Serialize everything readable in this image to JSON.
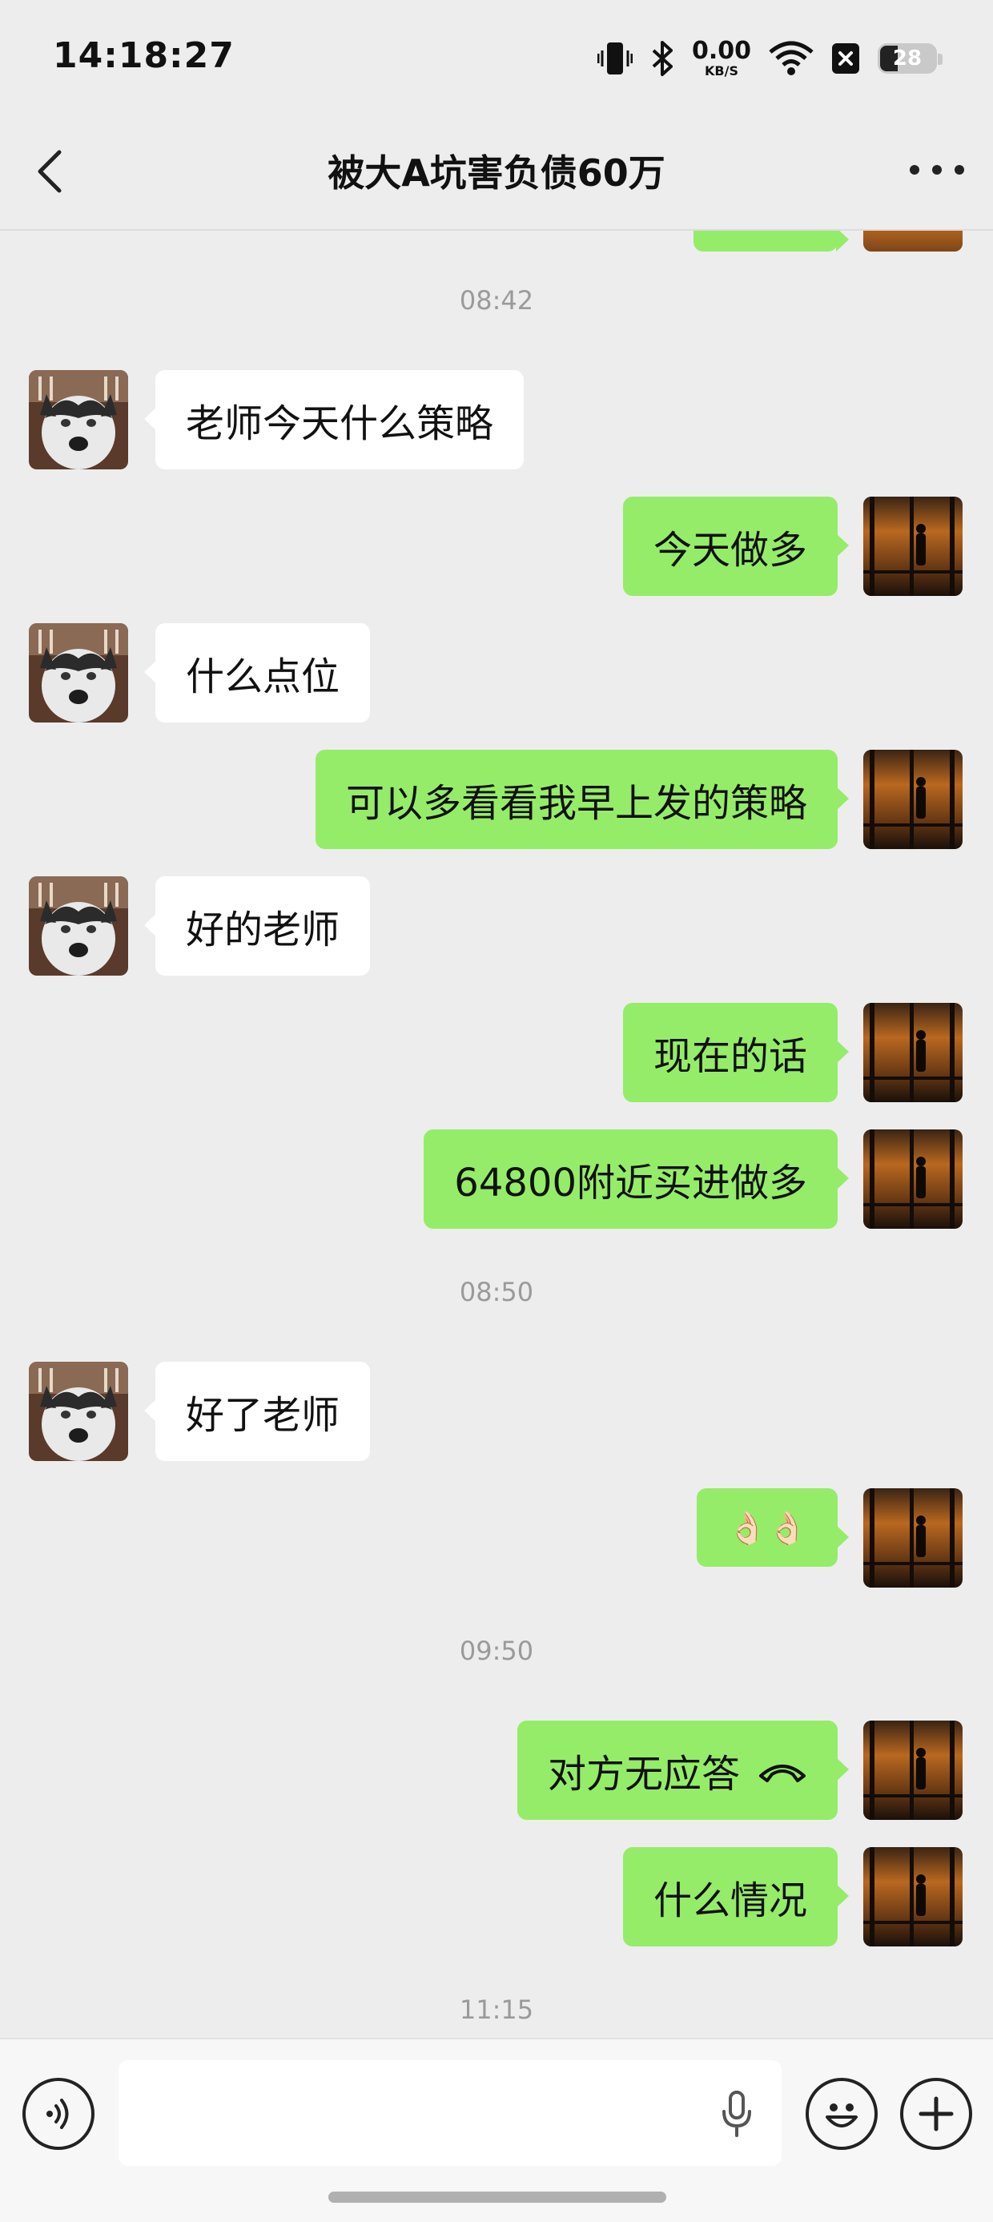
{
  "status_bar": {
    "time": "14:18:27",
    "net_speed_value": "0.00",
    "net_speed_unit": "KB/S",
    "battery": "28",
    "icons": [
      "vibrate-icon",
      "bluetooth-icon",
      "wifi-icon",
      "no-sim-icon",
      "battery-icon"
    ]
  },
  "header": {
    "title": "被大A坑害负债60万",
    "back_icon": "back-chevron-icon",
    "more_icon": "more-dots-icon"
  },
  "timestamps": [
    "08:42",
    "08:50",
    "09:50",
    "11:15"
  ],
  "messages": [
    {
      "side": "left",
      "text": "老师今天什么策略"
    },
    {
      "side": "right",
      "text": "今天做多"
    },
    {
      "side": "left",
      "text": "什么点位"
    },
    {
      "side": "right",
      "text": "可以多看看我早上发的策略"
    },
    {
      "side": "left",
      "text": "好的老师"
    },
    {
      "side": "right",
      "text": "现在的话"
    },
    {
      "side": "right",
      "text": "64800附近买进做多"
    },
    {
      "side": "left",
      "text": "好了老师"
    },
    {
      "side": "right",
      "text": "👌🏻👌🏻"
    },
    {
      "side": "right",
      "text": "对方无应答",
      "icon": "hang-up-phone-icon"
    },
    {
      "side": "right",
      "text": "什么情况"
    }
  ],
  "input_bar": {
    "voice_icon": "voice-mode-icon",
    "mic_icon": "microphone-icon",
    "emoji_icon": "emoji-icon",
    "plus_icon": "plus-icon",
    "text_value": ""
  },
  "colors": {
    "background": "#ededed",
    "sent_bubble": "#95ec69",
    "received_bubble": "#ffffff",
    "timestamp_text": "#9a9a9a"
  }
}
